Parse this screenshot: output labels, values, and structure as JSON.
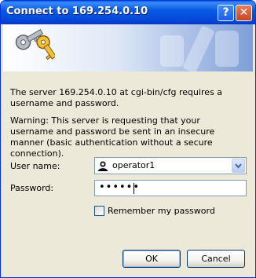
{
  "window": {
    "title": "Connect to 169.254.0.10",
    "help_label": "?",
    "close_label": "✕"
  },
  "banner": {
    "icon": "keys-icon"
  },
  "message": {
    "info": "The server 169.254.0.10 at cgi-bin/cfg requires a username and password.",
    "warning": "Warning: This server is requesting that your username and password be sent in an insecure manner (basic authentication without a secure connection)."
  },
  "form": {
    "username_label": "User name:",
    "username_value": "operator1",
    "password_label": "Password:",
    "password_value": "••••••",
    "remember_label": "Remember my password",
    "remember_checked": false
  },
  "buttons": {
    "ok": "OK",
    "cancel": "Cancel"
  },
  "colors": {
    "titlebar": "#0a5ae5",
    "dialog_bg": "#ece9d8",
    "input_border": "#7f9db9"
  }
}
